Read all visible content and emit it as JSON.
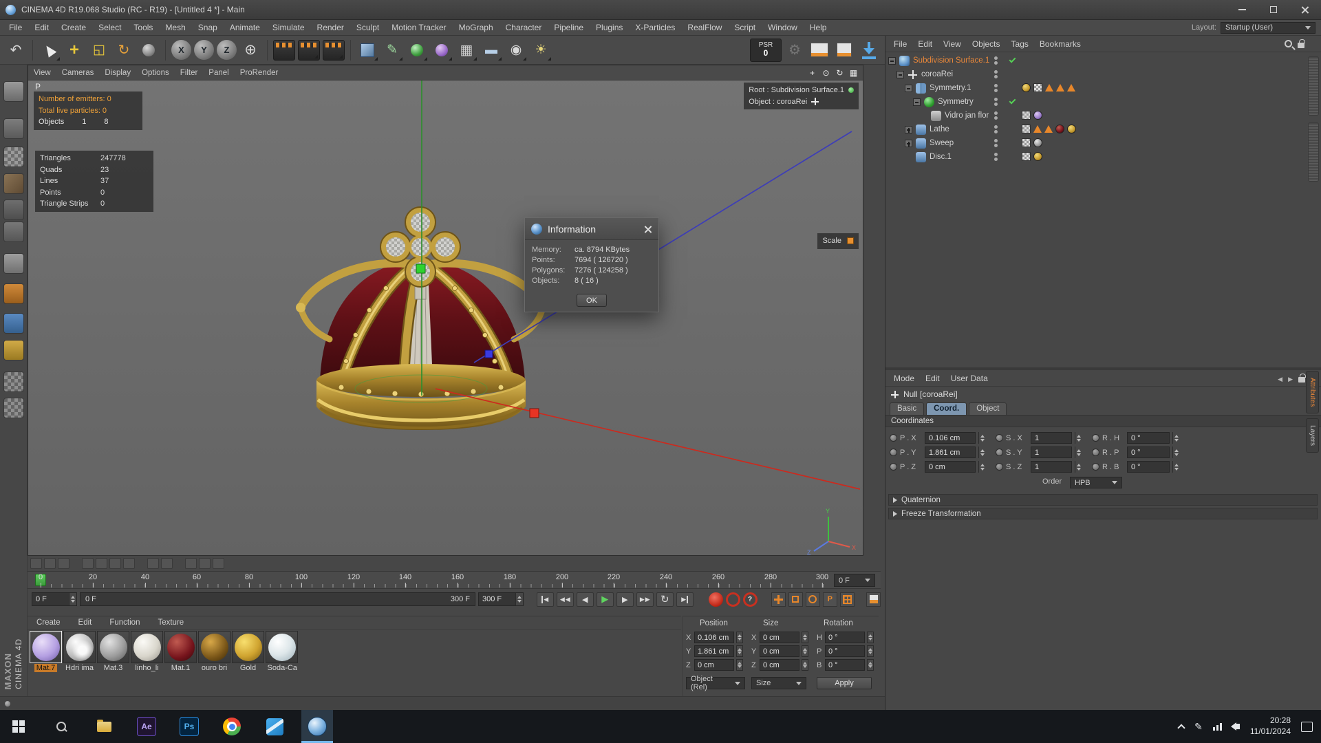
{
  "window": {
    "title": "CINEMA 4D R19.068 Studio (RC - R19) - [Untitled 4 *] - Main"
  },
  "menubar": {
    "items": [
      "File",
      "Edit",
      "Create",
      "Select",
      "Tools",
      "Mesh",
      "Snap",
      "Animate",
      "Simulate",
      "Render",
      "Sculpt",
      "Motion Tracker",
      "MoGraph",
      "Character",
      "Pipeline",
      "Plugins",
      "X-Particles",
      "RealFlow",
      "Script",
      "Window",
      "Help"
    ],
    "layout_label": "Layout:",
    "layout_value": "Startup (User)"
  },
  "toolbar": {
    "psr": "PSR",
    "psr_value": "0",
    "axes": [
      "X",
      "Y",
      "Z"
    ]
  },
  "viewport": {
    "menu": [
      "View",
      "Cameras",
      "Display",
      "Options",
      "Filter",
      "Panel",
      "ProRender"
    ],
    "camera_label": "P",
    "particles": {
      "line1": "Number of emitters: 0",
      "line2": "Total live particles: 0",
      "objects_label": "Objects",
      "objects_a": "1",
      "objects_b": "8"
    },
    "stats": [
      {
        "label": "Triangles",
        "value": "247778"
      },
      {
        "label": "Quads",
        "value": "23"
      },
      {
        "label": "Lines",
        "value": "37"
      },
      {
        "label": "Points",
        "value": "0"
      },
      {
        "label": "Triangle Strips",
        "value": "0"
      }
    ],
    "root_label": "Root : Subdivision Surface.1",
    "object_label": "Object : coroaRei",
    "scale_label": "Scale",
    "axis_widget": {
      "x": "X",
      "y": "Y",
      "z": "Z"
    }
  },
  "dialog": {
    "title": "Information",
    "rows": [
      {
        "label": "Memory:",
        "value": "ca. 8794 KBytes"
      },
      {
        "label": "Points:",
        "value": "7694 ( 126720 )"
      },
      {
        "label": "Polygons:",
        "value": "7276 ( 124258 )"
      },
      {
        "label": "Objects:",
        "value": "8 ( 16 )"
      }
    ],
    "ok_label": "OK"
  },
  "object_manager": {
    "menu": [
      "File",
      "Edit",
      "View",
      "Objects",
      "Tags",
      "Bookmarks"
    ],
    "items": [
      {
        "label": "Subdivision Surface.1"
      },
      {
        "label": "coroaRei"
      },
      {
        "label": "Symmetry.1"
      },
      {
        "label": "Symmetry"
      },
      {
        "label": "Vidro jan flor"
      },
      {
        "label": "Lathe"
      },
      {
        "label": "Sweep"
      },
      {
        "label": "Disc.1"
      }
    ]
  },
  "attributes": {
    "menu": [
      "Mode",
      "Edit",
      "User Data"
    ],
    "object_title": "Null [coroaRei]",
    "tabs": [
      "Basic",
      "Coord.",
      "Object"
    ],
    "section_title": "Coordinates",
    "rows": [
      {
        "p_label": "P . X",
        "p_value": "0.106 cm",
        "s_label": "S . X",
        "s_value": "1",
        "r_label": "R . H",
        "r_value": "0 °"
      },
      {
        "p_label": "P . Y",
        "p_value": "1.861 cm",
        "s_label": "S . Y",
        "s_value": "1",
        "r_label": "R . P",
        "r_value": "0 °"
      },
      {
        "p_label": "P . Z",
        "p_value": "0 cm",
        "s_label": "S . Z",
        "s_value": "1",
        "r_label": "R . B",
        "r_value": "0 °"
      }
    ],
    "order_label": "Order",
    "order_value": "HPB",
    "sections": [
      "Quaternion",
      "Freeze Transformation"
    ],
    "side_tabs": [
      "Attributes",
      "Layers"
    ]
  },
  "timeline": {
    "ticks": [
      "0",
      "20",
      "40",
      "60",
      "80",
      "100",
      "120",
      "140",
      "160",
      "180",
      "200",
      "220",
      "240",
      "260",
      "280",
      "300"
    ],
    "ruler_field": "0 F",
    "frame_spin": "0 F",
    "slider_start": "0 F",
    "slider_end": "300 F",
    "end_spin": "300 F",
    "record_question": "?",
    "param_letter": "P"
  },
  "materials": {
    "menu": [
      "Create",
      "Edit",
      "Function",
      "Texture"
    ],
    "items": [
      {
        "name": "Mat.7"
      },
      {
        "name": "Hdri ima"
      },
      {
        "name": "Mat.3"
      },
      {
        "name": "linho_li"
      },
      {
        "name": "Mat.1"
      },
      {
        "name": "ouro bri"
      },
      {
        "name": "Gold"
      },
      {
        "name": "Soda-Ca"
      }
    ]
  },
  "coords_panel": {
    "headers": [
      "Position",
      "Size",
      "Rotation"
    ],
    "position": [
      {
        "axis": "X",
        "value": "0.106 cm"
      },
      {
        "axis": "Y",
        "value": "1.861 cm"
      },
      {
        "axis": "Z",
        "value": "0 cm"
      }
    ],
    "size": [
      {
        "axis": "X",
        "value": "0 cm"
      },
      {
        "axis": "Y",
        "value": "0 cm"
      },
      {
        "axis": "Z",
        "value": "0 cm"
      }
    ],
    "rotation": [
      {
        "axis": "H",
        "value": "0 °"
      },
      {
        "axis": "P",
        "value": "0 °"
      },
      {
        "axis": "B",
        "value": "0 °"
      }
    ],
    "object_dropdown": "Object (Rel)",
    "size_dropdown": "Size",
    "apply_label": "Apply"
  },
  "taskbar": {
    "ae": "Ae",
    "ps": "Ps",
    "time": "20:28",
    "date": "11/01/2024"
  },
  "branding": {
    "maxon": "MAXON",
    "cinema": "CINEMA 4D"
  }
}
